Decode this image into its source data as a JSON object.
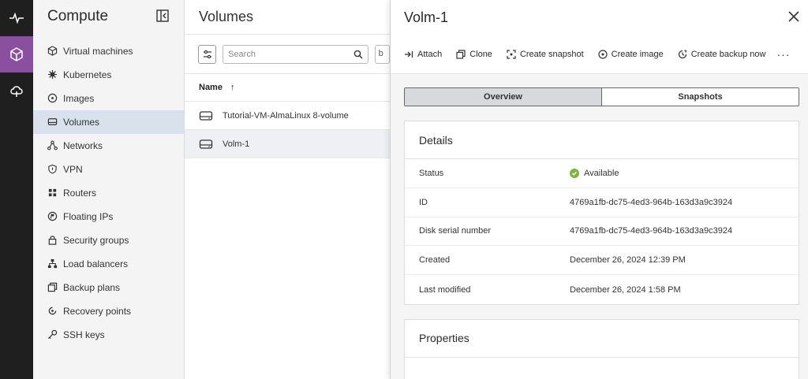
{
  "colors": {
    "rail_bg": "#1f1f1f",
    "rail_active": "#8a4f9e",
    "nav_active": "#d9e1ec",
    "status_ok": "#7cb342"
  },
  "rail": {
    "items": [
      {
        "icon": "activity-icon"
      },
      {
        "icon": "cube-icon",
        "active": true
      },
      {
        "icon": "cloud-upload-icon"
      }
    ]
  },
  "sidebar": {
    "title": "Compute",
    "items": [
      {
        "label": "Virtual machines",
        "icon": "cube-icon"
      },
      {
        "label": "Kubernetes",
        "icon": "kubernetes-icon"
      },
      {
        "label": "Images",
        "icon": "disc-icon"
      },
      {
        "label": "Volumes",
        "icon": "drive-icon",
        "active": true
      },
      {
        "label": "Networks",
        "icon": "network-icon"
      },
      {
        "label": "VPN",
        "icon": "shield-icon"
      },
      {
        "label": "Routers",
        "icon": "router-icon"
      },
      {
        "label": "Floating IPs",
        "icon": "floating-ip-icon"
      },
      {
        "label": "Security groups",
        "icon": "lock-icon"
      },
      {
        "label": "Load balancers",
        "icon": "hierarchy-icon"
      },
      {
        "label": "Backup plans",
        "icon": "backup-icon"
      },
      {
        "label": "Recovery points",
        "icon": "recovery-icon"
      },
      {
        "label": "SSH keys",
        "icon": "key-icon"
      }
    ]
  },
  "main": {
    "title": "Volumes",
    "search_placeholder": "Search",
    "extra_filter": "b",
    "column_name": "Name",
    "sort_arrow": "↑",
    "rows": [
      {
        "name": "Tutorial-VM-AlmaLinux 8-volume"
      },
      {
        "name": "Volm-1",
        "selected": true
      }
    ]
  },
  "drawer": {
    "title": "Volm-1",
    "actions": [
      {
        "label": "Attach",
        "icon": "attach-icon"
      },
      {
        "label": "Clone",
        "icon": "clone-icon"
      },
      {
        "label": "Create snapshot",
        "icon": "snapshot-icon"
      },
      {
        "label": "Create image",
        "icon": "image-icon"
      },
      {
        "label": "Create backup now",
        "icon": "backup-now-icon"
      }
    ],
    "more": "···",
    "tabs": [
      {
        "label": "Overview",
        "active": true
      },
      {
        "label": "Snapshots"
      }
    ],
    "details": {
      "title": "Details",
      "rows": [
        {
          "label": "Status",
          "value": "Available"
        },
        {
          "label": "ID",
          "value": "4769a1fb-dc75-4ed3-964b-163d3a9c3924"
        },
        {
          "label": "Disk serial number",
          "value": "4769a1fb-dc75-4ed3-964b-163d3a9c3924"
        },
        {
          "label": "Created",
          "value": "December 26, 2024 12:39 PM"
        },
        {
          "label": "Last modified",
          "value": "December 26, 2024 1:58 PM"
        }
      ]
    },
    "properties": {
      "title": "Properties"
    }
  }
}
